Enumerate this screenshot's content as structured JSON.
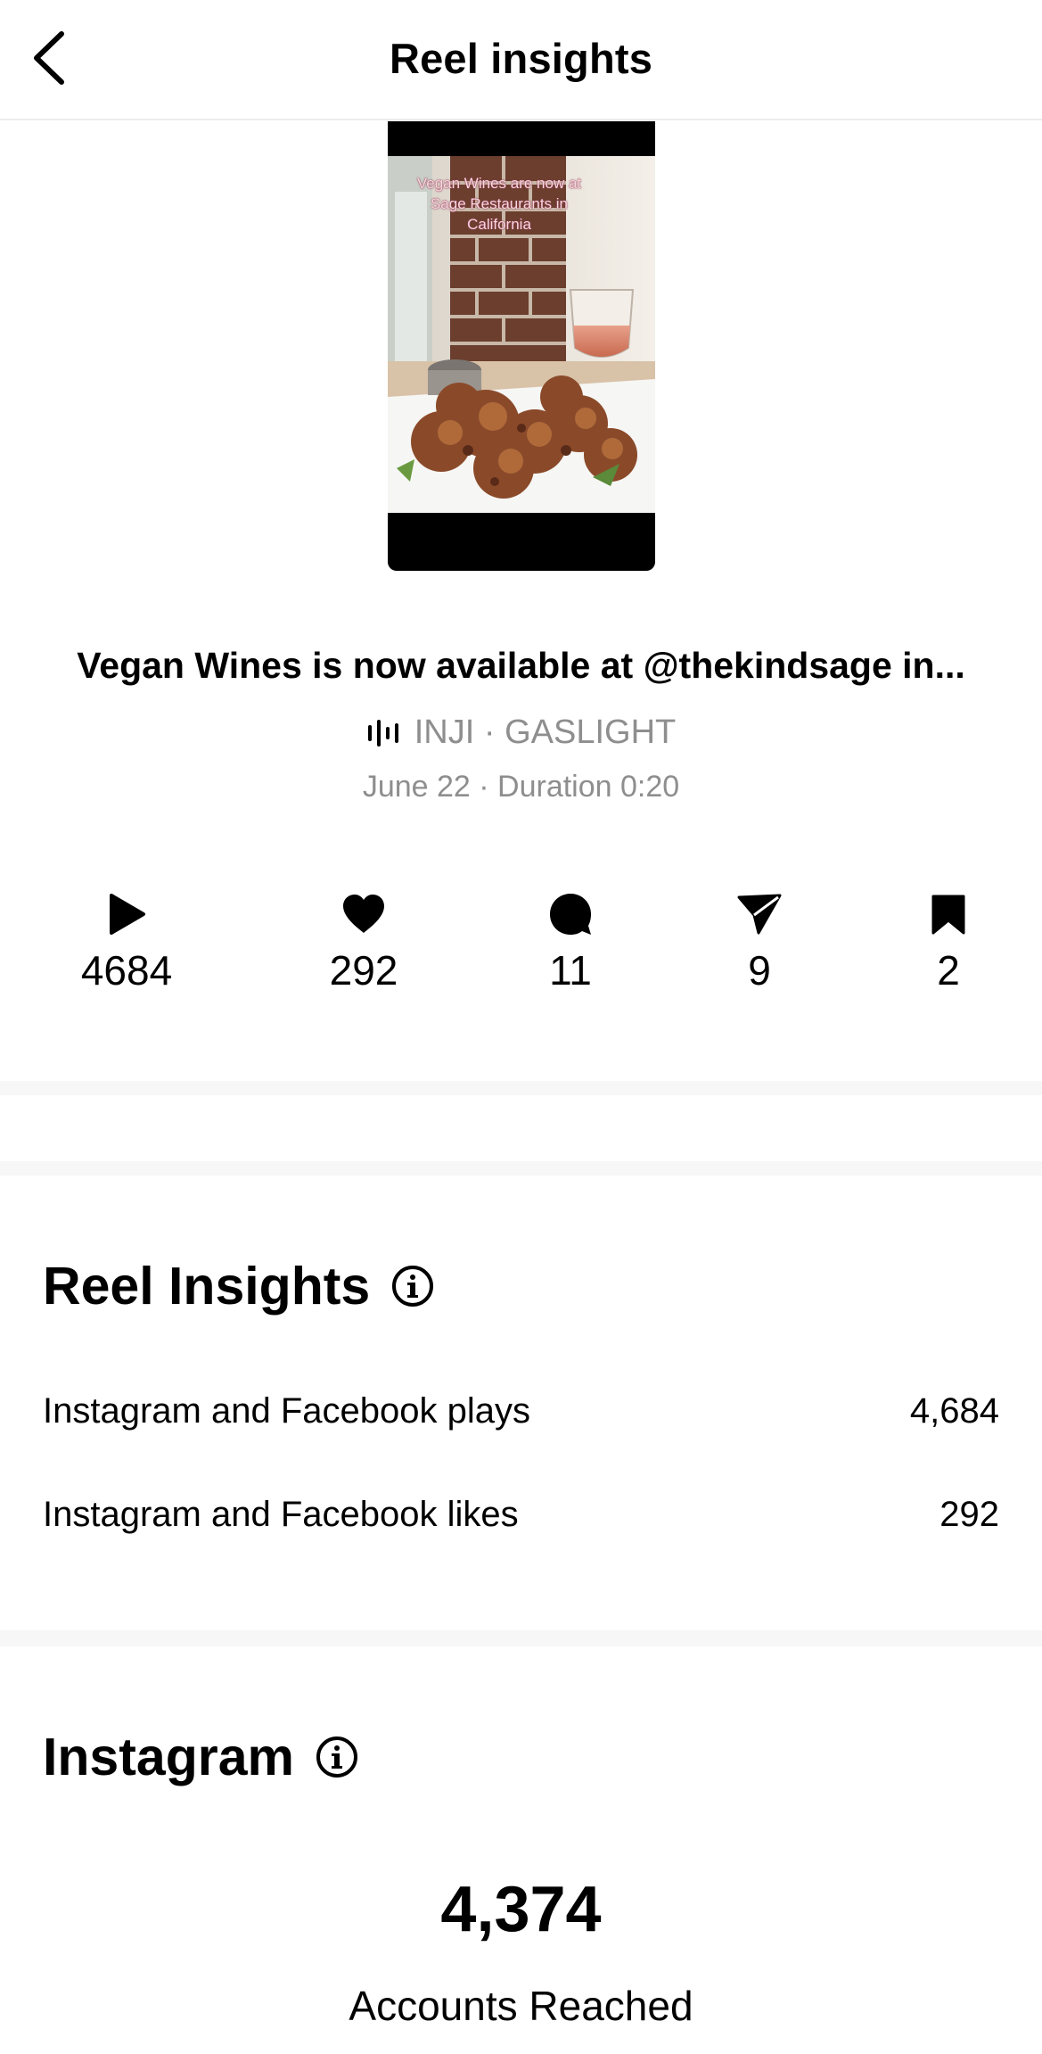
{
  "header": {
    "title": "Reel insights",
    "back_icon": "chevron-left-icon"
  },
  "reel": {
    "thumbnail_overlay_lines": [
      "Vegan Wines are now at",
      "Sage Restaurants in",
      "California"
    ],
    "caption": "Vegan Wines is now available at @thekindsage in...",
    "audio": {
      "icon": "audio-wave-icon",
      "text": "INJI · GASLIGHT"
    },
    "meta": "June 22 · Duration 0:20"
  },
  "stats": [
    {
      "icon": "play-icon",
      "value": "4684"
    },
    {
      "icon": "heart-icon",
      "value": "292"
    },
    {
      "icon": "comment-icon",
      "value": "11"
    },
    {
      "icon": "share-icon",
      "value": "9"
    },
    {
      "icon": "bookmark-icon",
      "value": "2"
    }
  ],
  "reel_insights": {
    "title": "Reel Insights",
    "rows": [
      {
        "label": "Instagram and Facebook plays",
        "value": "4,684"
      },
      {
        "label": "Instagram and Facebook likes",
        "value": "292"
      }
    ]
  },
  "instagram": {
    "title": "Instagram",
    "accounts_reached": "4,374",
    "accounts_reached_label": "Accounts Reached"
  }
}
